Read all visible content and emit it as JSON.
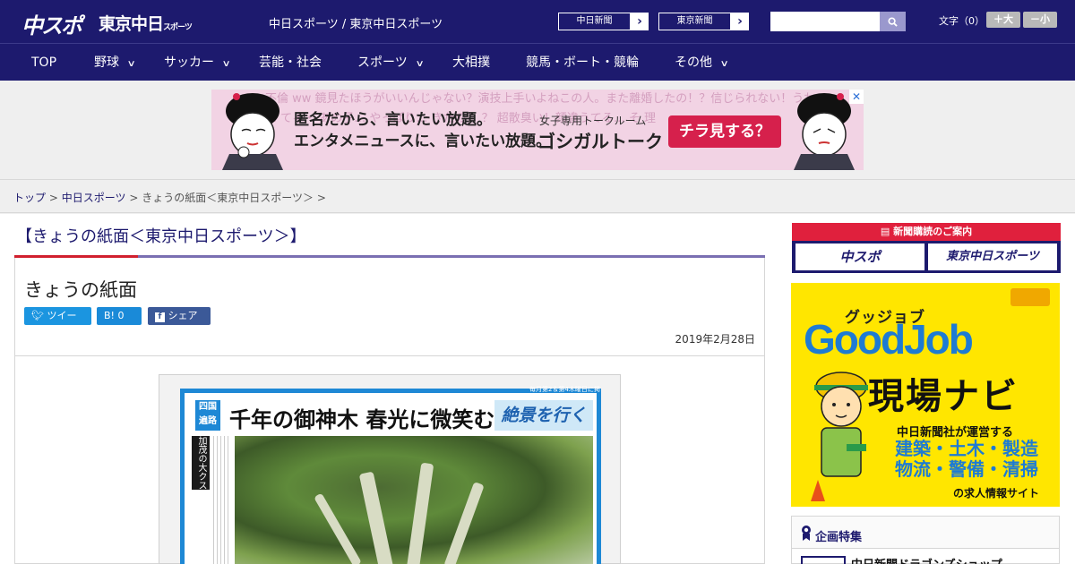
{
  "header": {
    "logo_main": "中スポ",
    "logo_tokyo": "東京中日",
    "logo_tokyo_suffix": "スポーツ",
    "site_title": "中日スポーツ / 東京中日スポーツ",
    "links": [
      {
        "label": "中日新聞"
      },
      {
        "label": "東京新聞"
      }
    ],
    "search_placeholder": "",
    "font_size_label": "文字（0）",
    "font_bigger": "＋大",
    "font_smaller": "－小"
  },
  "nav": {
    "items": [
      {
        "label": "TOP",
        "has_menu": false
      },
      {
        "label": "野球",
        "has_menu": true
      },
      {
        "label": "サッカー",
        "has_menu": true
      },
      {
        "label": "芸能・社会",
        "has_menu": false
      },
      {
        "label": "スポーツ",
        "has_menu": true
      },
      {
        "label": "大相撲",
        "has_menu": false
      },
      {
        "label": "競馬・ボート・競輪",
        "has_menu": false
      },
      {
        "label": "その他",
        "has_menu": true
      }
    ]
  },
  "ad": {
    "bg_line1": "不倫   ww    鏡見たほうがいいんじゃない？演技上手いよねこの人。また離婚したの！？信じられない！うわ",
    "bg_line2": "に   てる・    あの子…  やっぱり…  きたの？    ？      超散臭い！顔違うてる…  そ   理",
    "main_line1": "匿名だから、言いたい放題。",
    "main_line2": "エンタメニュースに、言いたい放題。",
    "sub": "女子専用トークルーム",
    "brand": "ゴシガルトーク",
    "cta": "チラ見する？",
    "close": "✕"
  },
  "breadcrumb": {
    "home": "トップ",
    "section": "中日スポーツ",
    "current": "きょうの紙面＜東京中日スポーツ＞",
    "sep": ">"
  },
  "article": {
    "section_title": "【きょうの紙面＜東京中日スポーツ＞】",
    "title": "きょうの紙面",
    "share": {
      "tweet": "ツイート",
      "hatena": "B! 0",
      "facebook": "シェア 0"
    },
    "date": "2019年2月28日",
    "paper": {
      "kicker": "四国",
      "kicker2": "遍路",
      "headline": "千年の御神木 春光に微笑む",
      "logo": "絶景を行く",
      "issue": "毎月第2＆第4木曜日に掲載",
      "side_label": "加茂の大クス"
    }
  },
  "sidebar": {
    "subscribe_head": "新聞購読のご案内",
    "subscribe_links": [
      {
        "label": "中スポ"
      },
      {
        "label": "東京中日スポーツ"
      }
    ],
    "goodjob": {
      "kana": "グッジョブ",
      "logo": "GoodJob",
      "title": "現場ナビ",
      "line1": "中日新聞社が運営する",
      "line2a": "建築・土木・製造",
      "line2b": "物流・警備・清掃",
      "line3": "の求人情報サイト"
    },
    "feature_title": "企画特集",
    "feature_item": "中日新聞ドラゴンズショップ"
  },
  "colors": {
    "brand_navy": "#1d1a6e",
    "accent_red": "#d1202e",
    "goodjob_yellow": "#ffe600",
    "goodjob_blue": "#1e7bd3"
  }
}
